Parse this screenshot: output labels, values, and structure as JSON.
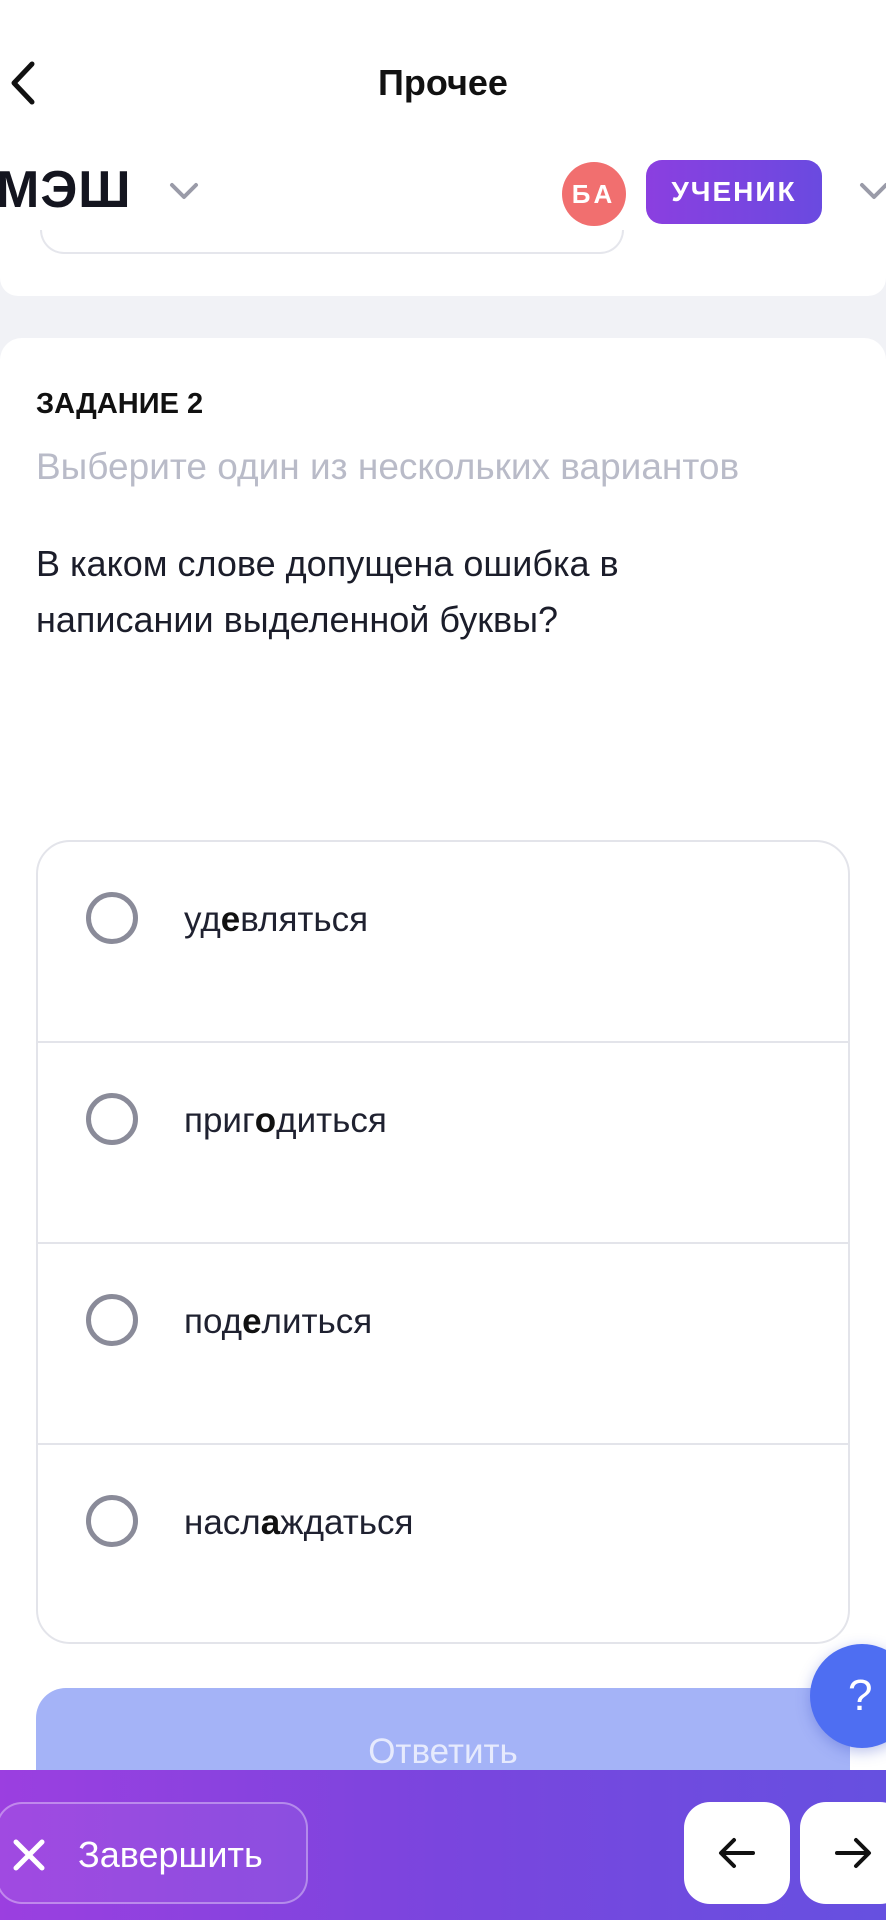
{
  "header": {
    "title": "Прочее",
    "logo": "МЭШ",
    "avatar_initials": "БА",
    "role": "УЧЕНИК"
  },
  "task": {
    "number": "ЗАДАНИЕ 2",
    "hint": "Выберите один из нескольких вариантов",
    "question": "В каком слове допущена ошибка в написании выделенной буквы?",
    "options": [
      {
        "pre": "уд",
        "bold": "е",
        "post": "вляться",
        "selected": false
      },
      {
        "pre": "приг",
        "bold": "о",
        "post": "диться",
        "selected": false
      },
      {
        "pre": "под",
        "bold": "е",
        "post": "литься",
        "selected": false
      },
      {
        "pre": "насл",
        "bold": "а",
        "post": "ждаться",
        "selected": false
      }
    ]
  },
  "actions": {
    "answer": "Ответить",
    "help": "?",
    "finish": "Завершить"
  },
  "icons": {
    "back": "chevron-left-icon",
    "dropdown": "chevron-down-icon",
    "close": "close-icon",
    "prev": "arrow-left-icon",
    "next": "arrow-right-icon"
  },
  "colors": {
    "accent": "#7a45de",
    "avatar": "#f16f6f",
    "answer_disabled": "#a4b3f7",
    "help": "#4e6ef2"
  }
}
